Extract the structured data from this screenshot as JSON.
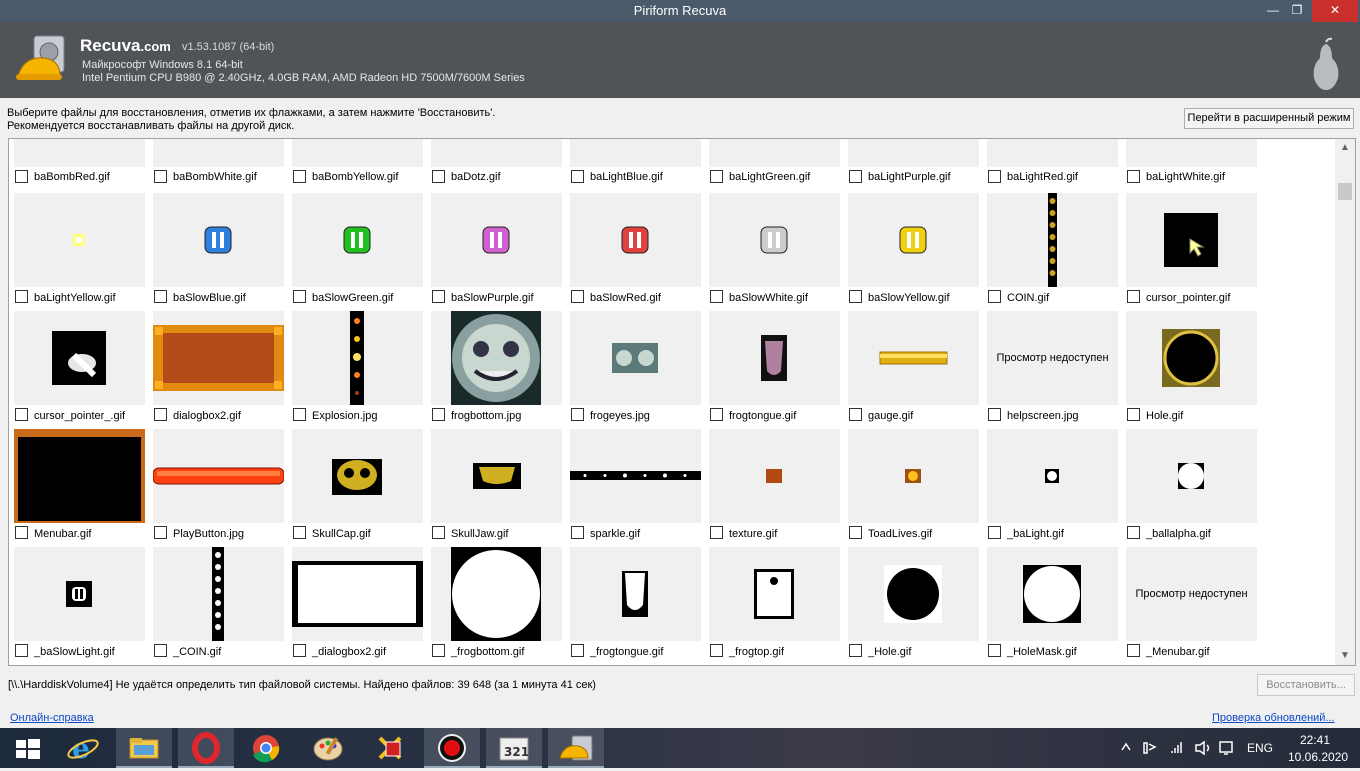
{
  "window": {
    "title": "Piriform Recuva",
    "min": "—",
    "max": "❐",
    "close": "✕"
  },
  "header": {
    "brand": "Recuva",
    "brand_suffix": ".com",
    "version": "v1.53.1087 (64-bit)",
    "os": "Майкрософт Windows 8.1 64-bit",
    "hardware": "Intel Pentium CPU B980 @ 2.40GHz, 4.0GB RAM, AMD Radeon HD 7500M/7600M Series"
  },
  "instructions": {
    "line1": "Выберите файлы для восстановления, отметив их флажками, а затем нажмите 'Восстановить'.",
    "line2": "Рекомендуется восстанавливать файлы на другой диск."
  },
  "advanced_button": "Перейти в расширенный режим",
  "no_preview_text": "Просмотр недоступен",
  "files": [
    [
      "baBombRed.gif",
      "baBombWhite.gif",
      "baBombYellow.gif",
      "baDotz.gif",
      "baLightBlue.gif",
      "baLightGreen.gif",
      "baLightPurple.gif",
      "baLightRed.gif",
      "baLightWhite.gif"
    ],
    [
      "baLightYellow.gif",
      "baSlowBlue.gif",
      "baSlowGreen.gif",
      "baSlowPurple.gif",
      "baSlowRed.gif",
      "baSlowWhite.gif",
      "baSlowYellow.gif",
      "COIN.gif",
      "cursor_pointer.gif"
    ],
    [
      "cursor_pointer_.gif",
      "dialogbox2.gif",
      "Explosion.jpg",
      "frogbottom.jpg",
      "frogeyes.jpg",
      "frogtongue.gif",
      "gauge.gif",
      "helpscreen.jpg",
      "Hole.gif"
    ],
    [
      "Menubar.gif",
      "PlayButton.jpg",
      "SkullCap.gif",
      "SkullJaw.gif",
      "sparkle.gif",
      "texture.gif",
      "ToadLives.gif",
      "_baLight.gif",
      "_ballalpha.gif"
    ],
    [
      "_baSlowLight.gif",
      "_COIN.gif",
      "_dialogbox2.gif",
      "_frogbottom.gif",
      "_frogtongue.gif",
      "_frogtop.gif",
      "_Hole.gif",
      "_HoleMask.gif",
      "_Menubar.gif"
    ]
  ],
  "status": "[\\\\.\\HarddiskVolume4] Не удаётся определить тип файловой системы. Найдено файлов: 39 648 (за 1 минута 41 сек)",
  "restore_button": "Восстановить...",
  "help_link": "Онлайн-справка",
  "updates_link": "Проверка обновлений...",
  "taskbar": {
    "lang": "ENG",
    "time": "22:41",
    "date": "10.06.2020",
    "apps": [
      "start-icon",
      "internet-explorer-icon",
      "file-explorer-icon",
      "opera-icon",
      "chrome-icon",
      "paint-icon",
      "game-app-icon",
      "record-app-icon",
      "media-app-icon",
      "recuva-app-icon"
    ]
  }
}
